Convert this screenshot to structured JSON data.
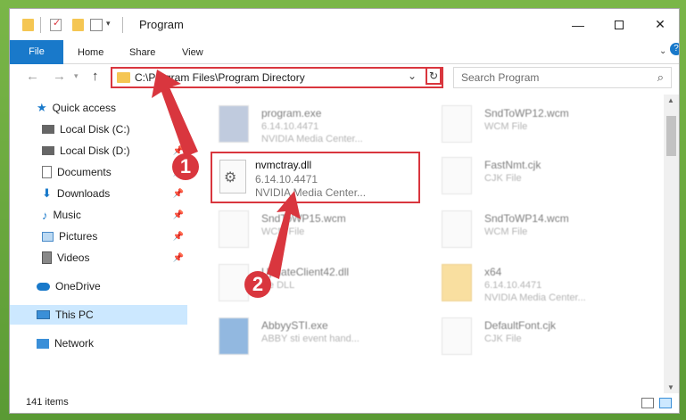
{
  "window": {
    "title": "Program"
  },
  "ribbon": {
    "file": "File",
    "home": "Home",
    "share": "Share",
    "view": "View"
  },
  "nav": {
    "address": "C:\\Program Files\\Program Directory",
    "search_placeholder": "Search Program"
  },
  "sidebar": {
    "items": [
      {
        "label": "Quick access"
      },
      {
        "label": "Local Disk (C:)"
      },
      {
        "label": "Local Disk (D:)"
      },
      {
        "label": "Documents"
      },
      {
        "label": "Downloads"
      },
      {
        "label": "Music"
      },
      {
        "label": "Pictures"
      },
      {
        "label": "Videos"
      },
      {
        "label": "OneDrive"
      },
      {
        "label": "This PC"
      },
      {
        "label": "Network"
      }
    ]
  },
  "files": [
    {
      "name": "program.exe",
      "line1": "6.14.10.4471",
      "line2": "NVIDIA Media Center..."
    },
    {
      "name": "SndToWP12.wcm",
      "line1": "WCM File",
      "line2": ""
    },
    {
      "name": "FastNmt.cjk",
      "line1": "CJK File",
      "line2": ""
    },
    {
      "name": "SndToWP15.wcm",
      "line1": "WCM File",
      "line2": ""
    },
    {
      "name": "SndToWP14.wcm",
      "line1": "WCM File",
      "line2": ""
    },
    {
      "name": "UpdateClient42.dll",
      "line1": "ice DLL",
      "line2": ""
    },
    {
      "name": "x64",
      "line1": "6.14.10.4471",
      "line2": "NVIDIA Media Center..."
    },
    {
      "name": "AbbyySTI.exe",
      "line1": "ABBY sti event hand...",
      "line2": ""
    },
    {
      "name": "DefaultFont.cjk",
      "line1": "CJK File",
      "line2": ""
    }
  ],
  "highlight": {
    "name": "nvmctray.dll",
    "line1": "6.14.10.4471",
    "line2": "NVIDIA Media Center..."
  },
  "badges": {
    "one": "1",
    "two": "2"
  },
  "status": {
    "items": "141 items"
  },
  "colors": {
    "accent": "#1979ca",
    "highlight": "#d9363e",
    "folder": "#f5c653"
  }
}
